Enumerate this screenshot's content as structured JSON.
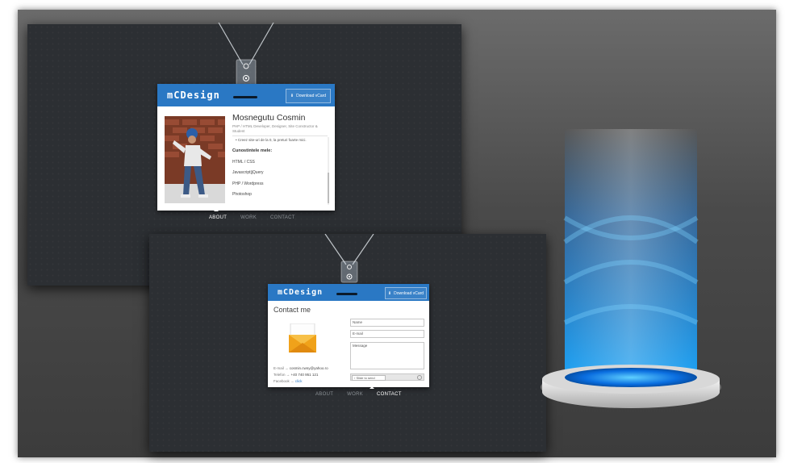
{
  "screen1": {
    "logo": "mCDesign",
    "download_label": "Download vCard",
    "name": "Mosnegutu Cosmin",
    "subtitle": "PHP / HTML Developer, Designer, Site Constructor & Student",
    "bullet": "Creez site-uri de la 0, la preturi foarte mici.",
    "skills_heading": "Cunostintele mele:",
    "skills": [
      "HTML / CSS",
      "Javascript|jQuery",
      "PHP / Wordpress",
      "Photoshop"
    ],
    "nav": [
      "ABOUT",
      "WORK",
      "CONTACT"
    ],
    "active_nav": "ABOUT"
  },
  "screen2": {
    "logo": "mCDesign",
    "download_label": "Download vCard",
    "heading": "Contact me",
    "email_label": "E-mail →",
    "email": "cosmin.cwny@yahoo.ro",
    "phone_label": "Telefon →",
    "phone": "+40 740 951 121",
    "facebook_label": "Facebook →",
    "facebook": "click",
    "name_placeholder": "Name",
    "email_placeholder": "E-mail",
    "message_placeholder": "Message",
    "slider_label": "Slide to send",
    "nav": [
      "ABOUT",
      "WORK",
      "CONTACT"
    ],
    "active_nav": "CONTACT"
  },
  "colors": {
    "brand_blue": "#2a78c4",
    "glow_blue": "#1f8fff",
    "dark_bg": "#2c2f33"
  }
}
